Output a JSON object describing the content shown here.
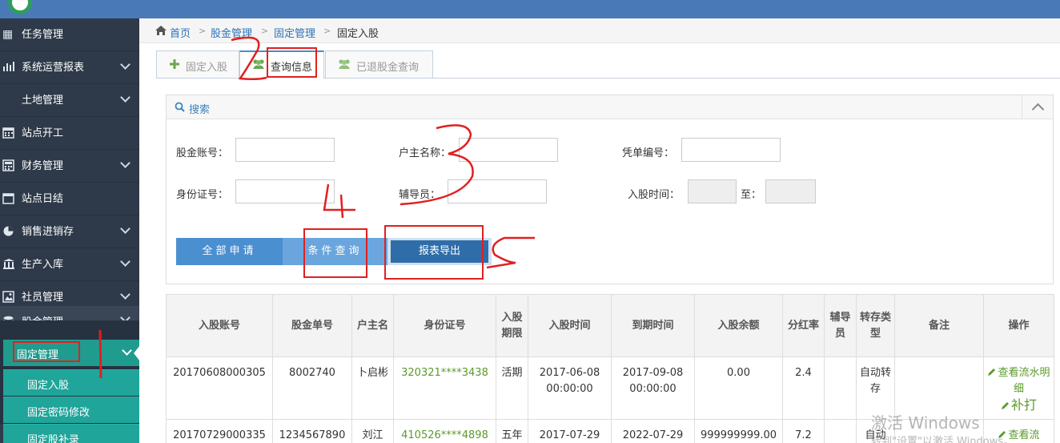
{
  "sidebar": {
    "items": [
      {
        "label": "任务管理",
        "icon": "tasks-icon",
        "has_children": false
      },
      {
        "label": "系统运营报表",
        "icon": "bar-chart-icon",
        "has_children": true
      },
      {
        "label": "土地管理",
        "icon": "",
        "has_children": true
      },
      {
        "label": "站点开工",
        "icon": "calendar-icon",
        "has_children": false
      },
      {
        "label": "财务管理",
        "icon": "calculator-icon",
        "has_children": true
      },
      {
        "label": "站点日结",
        "icon": "calendar-icon",
        "has_children": false
      },
      {
        "label": "销售进销存",
        "icon": "pie-chart-icon",
        "has_children": true
      },
      {
        "label": "生产入库",
        "icon": "bank-icon",
        "has_children": true
      },
      {
        "label": "社员管理",
        "icon": "picture-icon",
        "has_children": true
      },
      {
        "label": "股金管理",
        "icon": "database-icon",
        "has_children": true
      }
    ],
    "sub_head": "固定管理",
    "sub_items": [
      "固定入股",
      "固定密码修改",
      "固定股补录"
    ]
  },
  "breadcrumb": [
    "首页",
    "股金管理",
    "固定管理",
    "固定入股"
  ],
  "tabs": [
    {
      "label": "固定入股",
      "icon": "plus-icon"
    },
    {
      "label": "查询信息",
      "icon": "users-icon"
    },
    {
      "label": "已退股金查询",
      "icon": "users-icon"
    }
  ],
  "search": {
    "title": "搜索",
    "fields": {
      "account": {
        "label": "股金账号：",
        "value": ""
      },
      "owner": {
        "label": "户主名称：",
        "value": ""
      },
      "voucher": {
        "label": "凭单编号：",
        "value": ""
      },
      "idcard": {
        "label": "身份证号：",
        "value": ""
      },
      "assistant": {
        "label": "辅导员：",
        "value": ""
      },
      "time": {
        "label": "入股时间：",
        "to": "至："
      }
    },
    "buttons": {
      "all": "全部申请",
      "query": "条件查询",
      "export": "报表导出"
    }
  },
  "table": {
    "headers": [
      "入股账号",
      "股金单号",
      "户主名",
      "身份证号",
      "入股期限",
      "入股时间",
      "到期时间",
      "入股余额",
      "分红率",
      "辅导员",
      "转存类型",
      "备注",
      "操作"
    ],
    "rows": [
      {
        "account": "20170608000305",
        "order": "8002740",
        "owner": "卜启彬",
        "idno": "320321****3438",
        "term": "活期",
        "start": "2017-06-08 00:00:00",
        "end": "2017-09-08 00:00:00",
        "balance": "0.00",
        "rate": "2.4",
        "assistant": "",
        "transfer": "自动转存",
        "remark": "",
        "op1": "查看流水明细",
        "op2": "补打"
      },
      {
        "account": "20170729000335",
        "order": "1234567890",
        "owner": "刘江",
        "idno": "410526****4898",
        "term": "五年",
        "start": "2017-07-29",
        "end": "2022-07-29",
        "balance": "999999999.00",
        "rate": "7.2",
        "assistant": "",
        "transfer": "自动",
        "remark": "",
        "op1": "查看流",
        "op2": ""
      }
    ]
  },
  "watermark": {
    "line1": "激活 Windows",
    "line2": "转到\"设置\"以激活 Windows。"
  },
  "colors": {
    "topbar": "#4a79b8",
    "sidebar": "#2e3a49",
    "sub_menu": "#1fa59a",
    "link": "#2a73b8",
    "btn_all": "#4a8fd0",
    "btn_query": "#6aa6dd",
    "btn_export": "#2e6da8",
    "green_text": "#5b9a2a",
    "annotation": "#e02020"
  }
}
